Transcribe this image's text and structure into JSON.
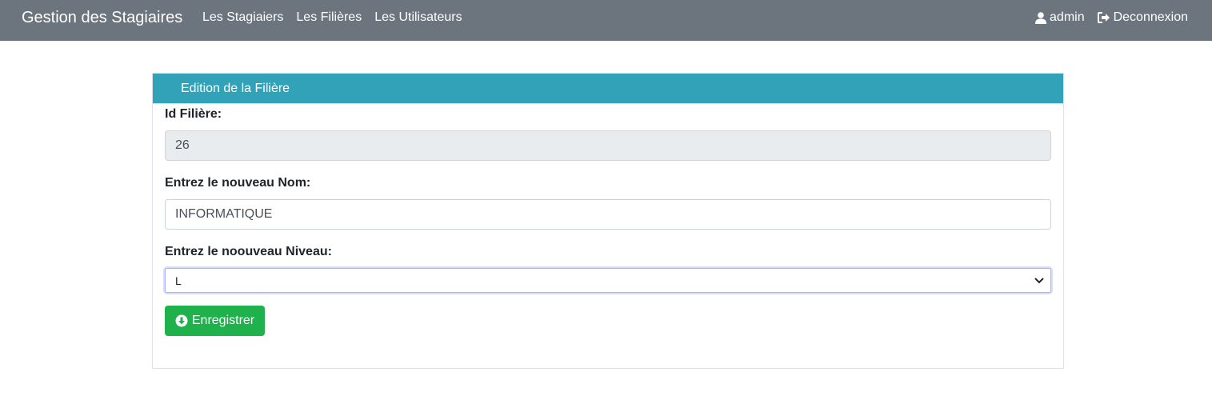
{
  "navbar": {
    "brand": "Gestion des Stagiaires",
    "links": [
      "Les Stagiaiers",
      "Les Filières",
      "Les Utilisateurs"
    ],
    "user": "admin",
    "logout": "Deconnexion",
    "bg_color": "#6c757d"
  },
  "card": {
    "title": "Edition de la Filière",
    "header_color": "#31a2b8",
    "id_label": "Id Filière:",
    "id_value": "26",
    "nom_label": "Entrez le nouveau Nom:",
    "nom_value": "INFORMATIQUE",
    "niveau_label": "Entrez le noouveau Niveau:",
    "niveau_value": "L",
    "save_label": "Enregistrer",
    "save_color": "#1eb14c"
  },
  "icons": [
    "user-icon",
    "sign-out-icon",
    "arrow-circle-down-icon",
    "chevron-down-icon"
  ]
}
